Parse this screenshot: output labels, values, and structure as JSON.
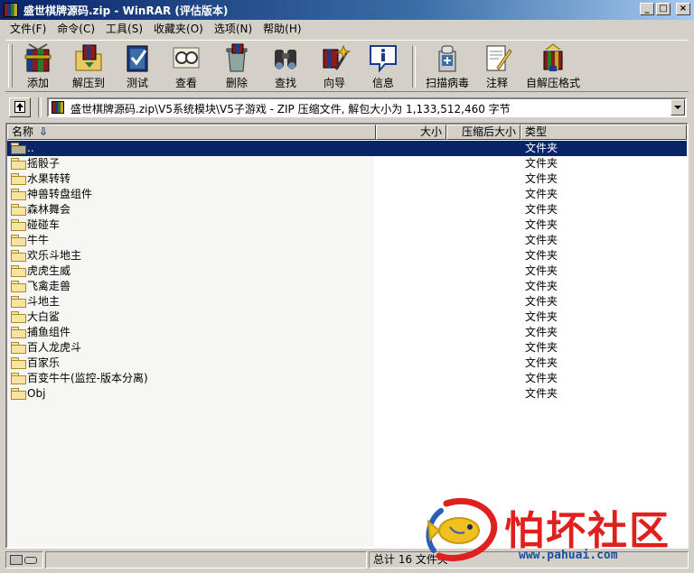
{
  "window": {
    "title": "盛世棋牌源码.zip - WinRAR (评估版本)"
  },
  "menu": [
    "文件(F)",
    "命令(C)",
    "工具(S)",
    "收藏夹(O)",
    "选项(N)",
    "帮助(H)"
  ],
  "toolbar": {
    "buttons": [
      {
        "label": "添加",
        "icon": "add-archive-icon"
      },
      {
        "label": "解压到",
        "icon": "extract-to-icon"
      },
      {
        "label": "测试",
        "icon": "test-icon"
      },
      {
        "label": "查看",
        "icon": "view-icon"
      },
      {
        "label": "删除",
        "icon": "delete-icon"
      },
      {
        "label": "查找",
        "icon": "find-icon"
      },
      {
        "label": "向导",
        "icon": "wizard-icon"
      },
      {
        "label": "信息",
        "icon": "info-icon"
      },
      {
        "label": "扫描病毒",
        "icon": "virus-scan-icon"
      },
      {
        "label": "注释",
        "icon": "comment-icon"
      },
      {
        "label": "自解压格式",
        "icon": "sfx-icon"
      }
    ]
  },
  "address": {
    "path": "盛世棋牌源码.zip\\V5系统模块\\V5子游戏 - ZIP 压缩文件, 解包大小为 1,133,512,460 字节"
  },
  "columns": {
    "name": "名称",
    "size": "大小",
    "packed": "压缩后大小",
    "type": "类型"
  },
  "rows": [
    {
      "name": "..",
      "type": "文件夹"
    },
    {
      "name": "摇骰子",
      "type": "文件夹"
    },
    {
      "name": "水果转转",
      "type": "文件夹"
    },
    {
      "name": "神兽转盘组件",
      "type": "文件夹"
    },
    {
      "name": "森林舞会",
      "type": "文件夹"
    },
    {
      "name": "碰碰车",
      "type": "文件夹"
    },
    {
      "name": "牛牛",
      "type": "文件夹"
    },
    {
      "name": "欢乐斗地主",
      "type": "文件夹"
    },
    {
      "name": "虎虎生威",
      "type": "文件夹"
    },
    {
      "name": "飞禽走兽",
      "type": "文件夹"
    },
    {
      "name": "斗地主",
      "type": "文件夹"
    },
    {
      "name": "大白鲨",
      "type": "文件夹"
    },
    {
      "name": "捕鱼组件",
      "type": "文件夹"
    },
    {
      "name": "百人龙虎斗",
      "type": "文件夹"
    },
    {
      "name": "百家乐",
      "type": "文件夹"
    },
    {
      "name": "百变牛牛(监控-版本分离)",
      "type": "文件夹"
    },
    {
      "name": "Obj",
      "type": "文件夹"
    }
  ],
  "status": {
    "summary": "总计 16 文件夹"
  },
  "watermark": {
    "text": "怕坏社区",
    "url": "www.pahuai.com"
  },
  "colors": {
    "selection": "#0a246a",
    "face": "#d4d0c8",
    "watermark_red": "#e0201c"
  }
}
